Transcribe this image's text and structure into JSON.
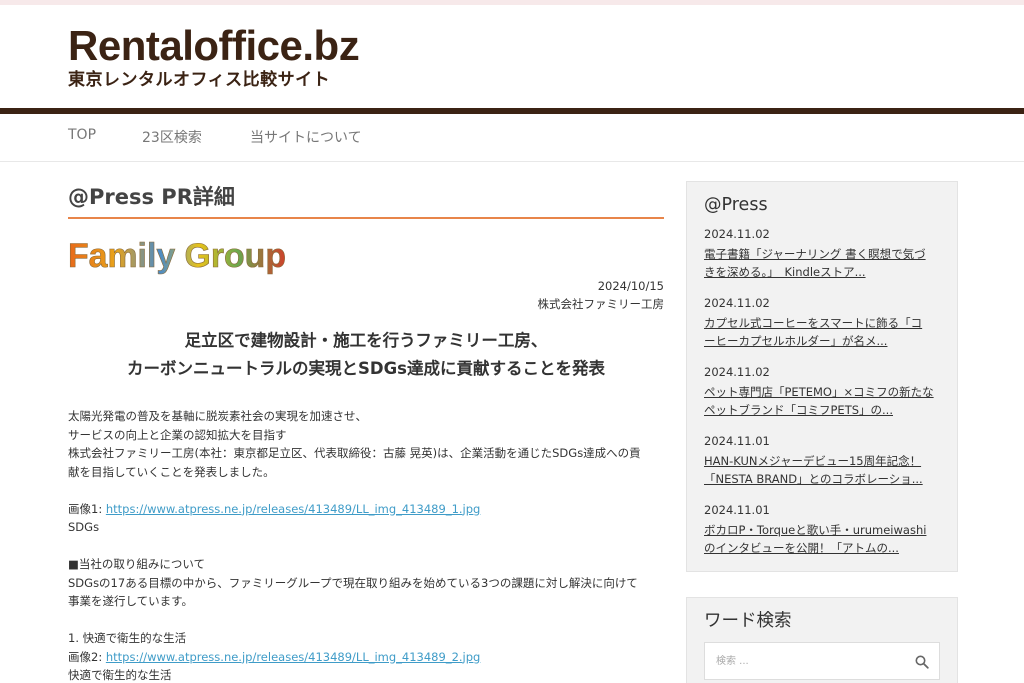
{
  "site": {
    "logo_main": "Rentaloffice.bz",
    "logo_sub": "東京レンタルオフィス比較サイト"
  },
  "nav": {
    "items": [
      {
        "label": "TOP"
      },
      {
        "label": "23区検索"
      },
      {
        "label": "当サイトについて"
      }
    ]
  },
  "main": {
    "page_title": "@Press PR詳細",
    "company_logo_text": "Family Group",
    "date": "2024/10/15",
    "company": "株式会社ファミリー工房",
    "headline_line1": "足立区で建物設計・施工を行うファミリー工房、",
    "headline_line2": "カーボンニュートラルの実現とSDGs達成に貢献することを発表",
    "para1": "太陽光発電の普及を基軸に脱炭素社会の実現を加速させ、",
    "para2": "サービスの向上と企業の認知拡大を目指す",
    "para3": "株式会社ファミリー工房(本社：東京都足立区、代表取締役：古藤 晃英)は、企業活動を通じたSDGs達成への貢",
    "para4": "献を目指していくことを発表しました。",
    "image1_label": "画像1: ",
    "image1_url": "https://www.atpress.ne.jp/releases/413489/LL_img_413489_1.jpg",
    "image1_caption": "SDGs",
    "section_heading": "■当社の取り組みについて",
    "section_text1": "SDGsの17ある目標の中から、ファミリーグループで現在取り組みを始めている3つの課題に対し解決に向けて",
    "section_text2": "事業を遂行しています。",
    "item1": "1. 快適で衛生的な生活",
    "image2_label": "画像2: ",
    "image2_url": "https://www.atpress.ne.jp/releases/413489/LL_img_413489_2.jpg",
    "image2_caption": "快適で衛生的な生活"
  },
  "sidebar": {
    "press_title": "@Press",
    "news": [
      {
        "date": "2024.11.02",
        "line1": "電子書籍「ジャーナリング 書く瞑想で気づ",
        "line2": "きを深める。」　Kindleストア..."
      },
      {
        "date": "2024.11.02",
        "line1": "カプセル式コーヒーをスマートに飾る「コ",
        "line2": "ーヒーカプセルホルダー」が名メ..."
      },
      {
        "date": "2024.11.02",
        "line1": "ペット専門店「PETEMO」×コミフの新たな",
        "line2": "ペットブランド「コミフPETS」の..."
      },
      {
        "date": "2024.11.01",
        "line1": "HAN-KUNメジャーデビュー15周年記念！",
        "line2": "「NESTA BRAND」とのコラボレーショ..."
      },
      {
        "date": "2024.11.01",
        "line1": "ボカロP・Torqueと歌い手・urumeiwashi",
        "line2": "のインタビューを公開！「アトムの..."
      }
    ],
    "search_title": "ワード検索",
    "search_placeholder": "検索 ..."
  },
  "colors": {
    "brand_brown": "#3b2314",
    "accent_orange": "#e8854a",
    "link_blue": "#3f9cc8"
  }
}
